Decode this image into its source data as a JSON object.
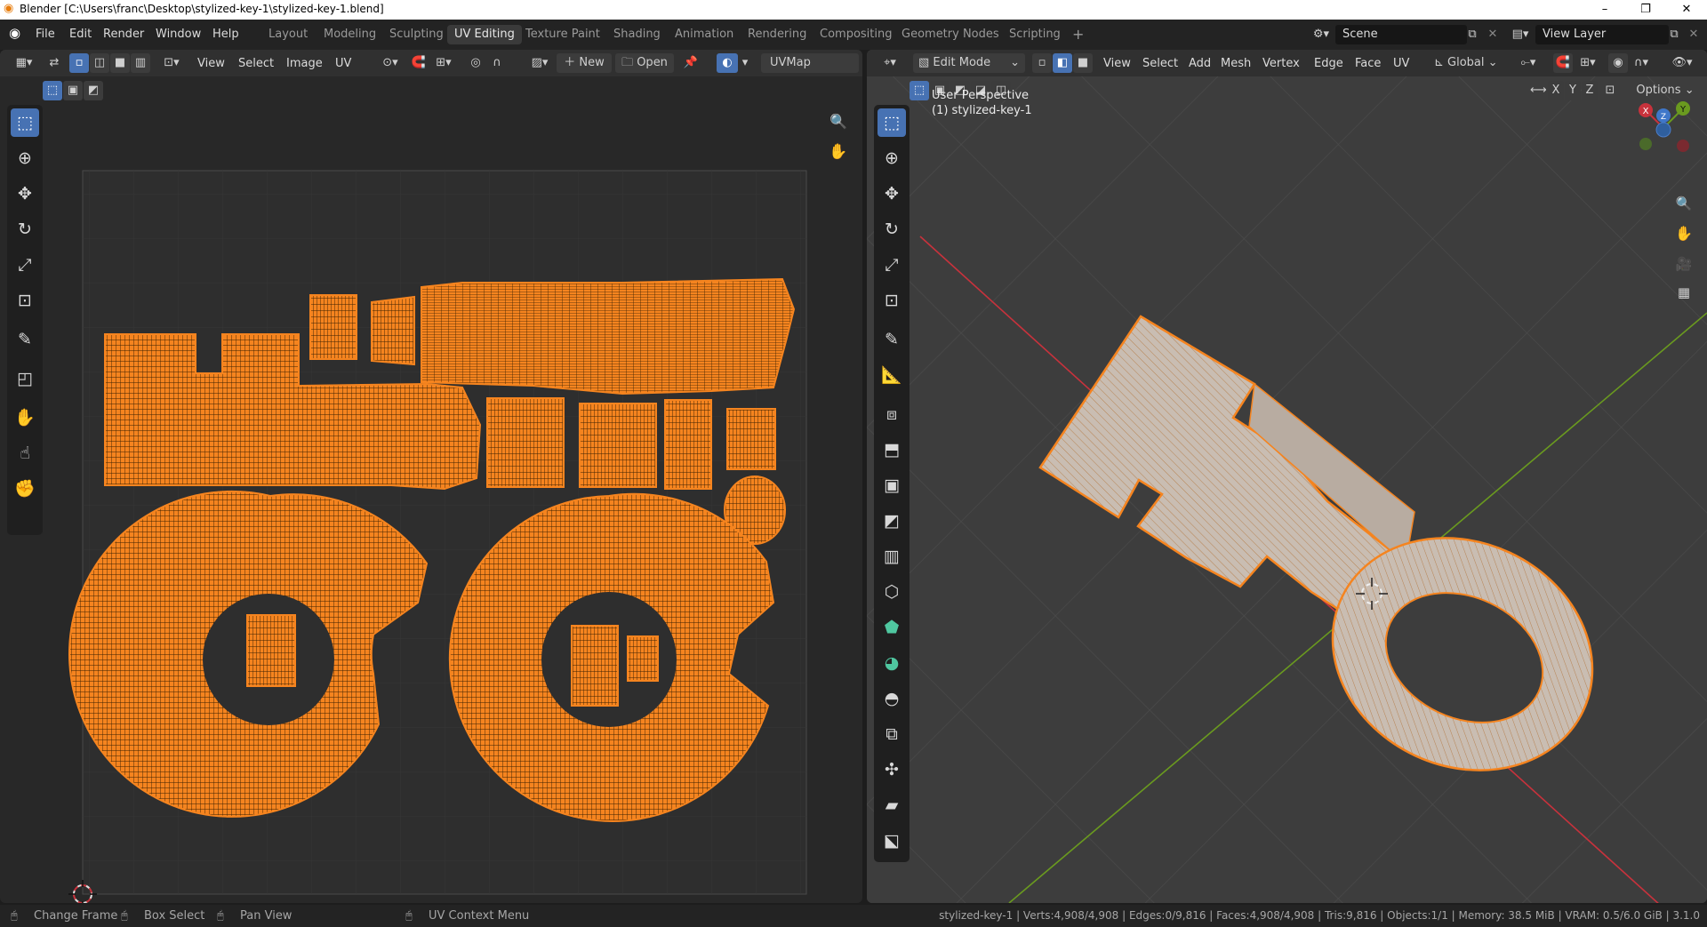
{
  "window": {
    "title": "Blender [C:\\Users\\franc\\Desktop\\stylized-key-1\\stylized-key-1.blend]",
    "controls": [
      "–",
      "❐",
      "✕"
    ]
  },
  "topbar": {
    "menus": [
      "File",
      "Edit",
      "Render",
      "Window",
      "Help"
    ],
    "workspaces": [
      "Layout",
      "Modeling",
      "Sculpting",
      "UV Editing",
      "Texture Paint",
      "Shading",
      "Animation",
      "Rendering",
      "Compositing",
      "Geometry Nodes",
      "Scripting"
    ],
    "active_workspace": "UV Editing",
    "add_tab": "+",
    "scene": "Scene",
    "view_layer": "View Layer"
  },
  "uv_editor": {
    "menus": [
      "View",
      "Select",
      "Image",
      "UV"
    ],
    "new_label": "New",
    "open_label": "Open",
    "uv_map": "UVMap"
  },
  "viewport": {
    "mode": "Edit Mode",
    "menus": [
      "View",
      "Select",
      "Add",
      "Mesh",
      "Vertex",
      "Edge",
      "Face",
      "UV"
    ],
    "transform_orientation": "Global",
    "axes": [
      "X",
      "Y",
      "Z"
    ],
    "options_label": "Options",
    "overlay_line1": "User Perspective",
    "overlay_line2": "(1) stylized-key-1",
    "gizmo": {
      "x": "X",
      "y": "Y",
      "z": "Z"
    }
  },
  "statusbar": {
    "change_frame": "Change Frame",
    "box_select": "Box Select",
    "pan_view": "Pan View",
    "context_menu": "UV Context Menu",
    "stats": "stylized-key-1 | Verts:4,908/4,908 | Edges:0/9,816 | Faces:4,908/4,908 | Tris:9,816 | Objects:1/1 | Memory: 38.5 MiB | VRAM: 0.5/6.0 GiB | 3.1.0"
  },
  "colors": {
    "selection": "#f5841f",
    "active_tool": "#4772b3",
    "x_axis": "#c8323c",
    "y_axis": "#6a9a1f",
    "mesh_fill": "#c9bdb2"
  },
  "icons": {
    "uv_tools": [
      "select-box-icon",
      "cursor-icon",
      "move-icon",
      "rotate-icon",
      "scale-icon",
      "transform-icon",
      "annotate-icon",
      "rip-icon",
      "grab-icon",
      "relax-icon",
      "pinch-icon"
    ],
    "view3d_tools": [
      "select-box-icon",
      "cursor-icon",
      "move-icon",
      "rotate-icon",
      "scale-icon",
      "transform-icon",
      "annotate-icon",
      "measure-icon",
      "add-cube-icon",
      "extrude-icon",
      "inset-icon",
      "bevel-icon",
      "loop-cut-icon",
      "knife-icon",
      "poly-build-icon",
      "spin-icon",
      "smooth-icon",
      "edge-slide-icon",
      "shrink-fatten-icon",
      "shear-icon",
      "rip-region-icon"
    ]
  }
}
